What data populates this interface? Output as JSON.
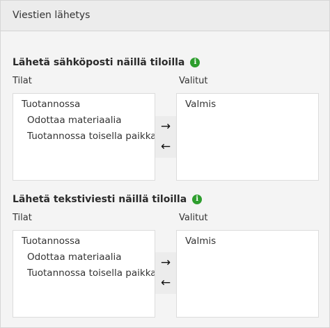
{
  "panel": {
    "title": "Viestien lähetys"
  },
  "email_section": {
    "title": "Lähetä sähköposti näillä tiloilla",
    "available_label": "Tilat",
    "selected_label": "Valitut",
    "available_items": [
      {
        "label": "Tuotannossa",
        "level": "group"
      },
      {
        "label": "Odottaa materiaalia",
        "level": "child"
      },
      {
        "label": "Tuotannossa toisella paikkakunnalla",
        "level": "child"
      }
    ],
    "selected_items": [
      {
        "label": "Valmis"
      }
    ],
    "move_right_glyph": "→",
    "move_left_glyph": "←",
    "info_glyph": "i"
  },
  "sms_section": {
    "title": "Lähetä tekstiviesti näillä tiloilla",
    "available_label": "Tilat",
    "selected_label": "Valitut",
    "available_items": [
      {
        "label": "Tuotannossa",
        "level": "group"
      },
      {
        "label": "Odottaa materiaalia",
        "level": "child"
      },
      {
        "label": "Tuotannossa toisella paikkakunnalla",
        "level": "child"
      }
    ],
    "selected_items": [
      {
        "label": "Valmis"
      }
    ],
    "move_right_glyph": "→",
    "move_left_glyph": "←",
    "info_glyph": "i"
  },
  "colors": {
    "info_icon": "#2e9e2e",
    "header_bg": "#ececec",
    "panel_bg": "#f4f4f4"
  }
}
